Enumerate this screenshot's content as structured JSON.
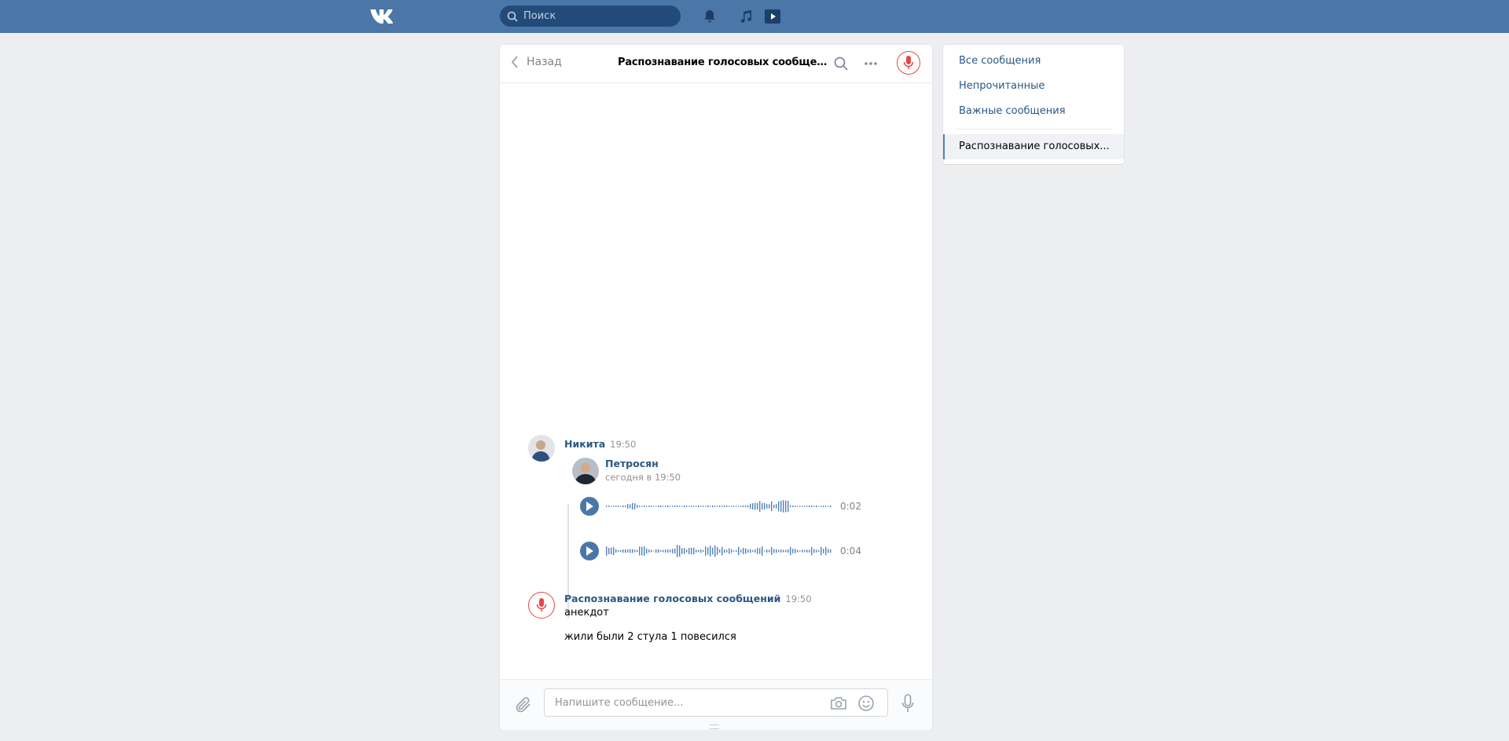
{
  "topbar": {
    "search_placeholder": "Поиск",
    "accent": "#4a76a8"
  },
  "chat": {
    "back_label": "Назад",
    "title": "Распознавание голосовых сообщений",
    "composer_placeholder": "Напишите сообщение..."
  },
  "messages": [
    {
      "author": "Никита",
      "time": "19:50",
      "forwarded": {
        "author": "Петросян",
        "date": "сегодня в 19:50",
        "audio": [
          {
            "duration": "0:02"
          },
          {
            "duration": "0:04"
          }
        ]
      }
    },
    {
      "author": "Распознавание голосовых сообщений",
      "time": "19:50",
      "lines": [
        "анекдот",
        "жили были 2 стула 1 повесился"
      ]
    }
  ],
  "menu": {
    "items": [
      "Все сообщения",
      "Непрочитанные",
      "Важные сообщения"
    ],
    "active_chat": "Распознавание голосовых..."
  }
}
